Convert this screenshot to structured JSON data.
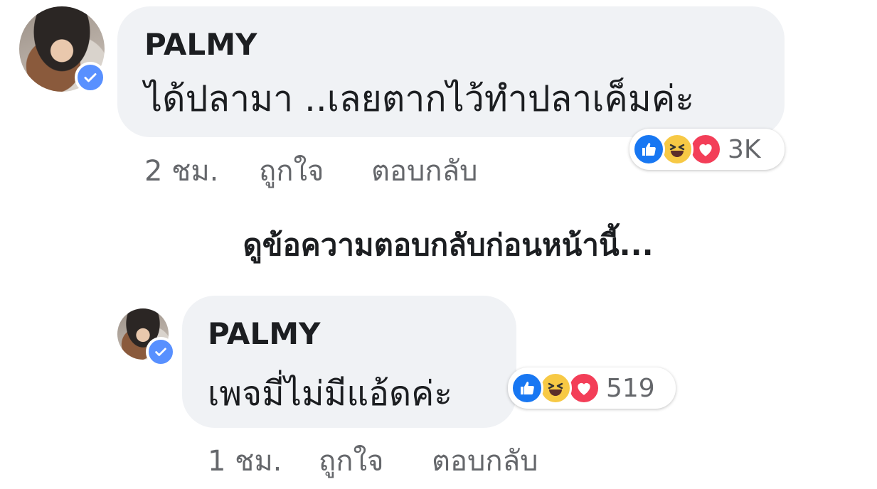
{
  "comments": [
    {
      "author": "PALMY",
      "text": "ได้ปลามา ..เลยตากไว้ทำปลาเค็มค่ะ",
      "time": "2 ชม.",
      "like_label": "ถูกใจ",
      "reply_label": "ตอบกลับ",
      "reactions": [
        "like-icon",
        "haha-icon",
        "love-icon"
      ],
      "reaction_count": "3K"
    },
    {
      "author": "PALMY",
      "text": "เพจมี่ไม่มีแอ้ดค่ะ",
      "time": "1 ชม.",
      "like_label": "ถูกใจ",
      "reply_label": "ตอบกลับ",
      "reactions": [
        "like-icon",
        "haha-icon",
        "love-icon"
      ],
      "reaction_count": "519"
    }
  ],
  "view_previous_replies": "ดูข้อความตอบกลับก่อนหน้านี้...",
  "colors": {
    "bubble": "#f0f2f5",
    "verified": "#5890ff",
    "like": "#1877f2",
    "haha": "#f7c945",
    "love": "#f33e58",
    "meta": "#65676b"
  }
}
